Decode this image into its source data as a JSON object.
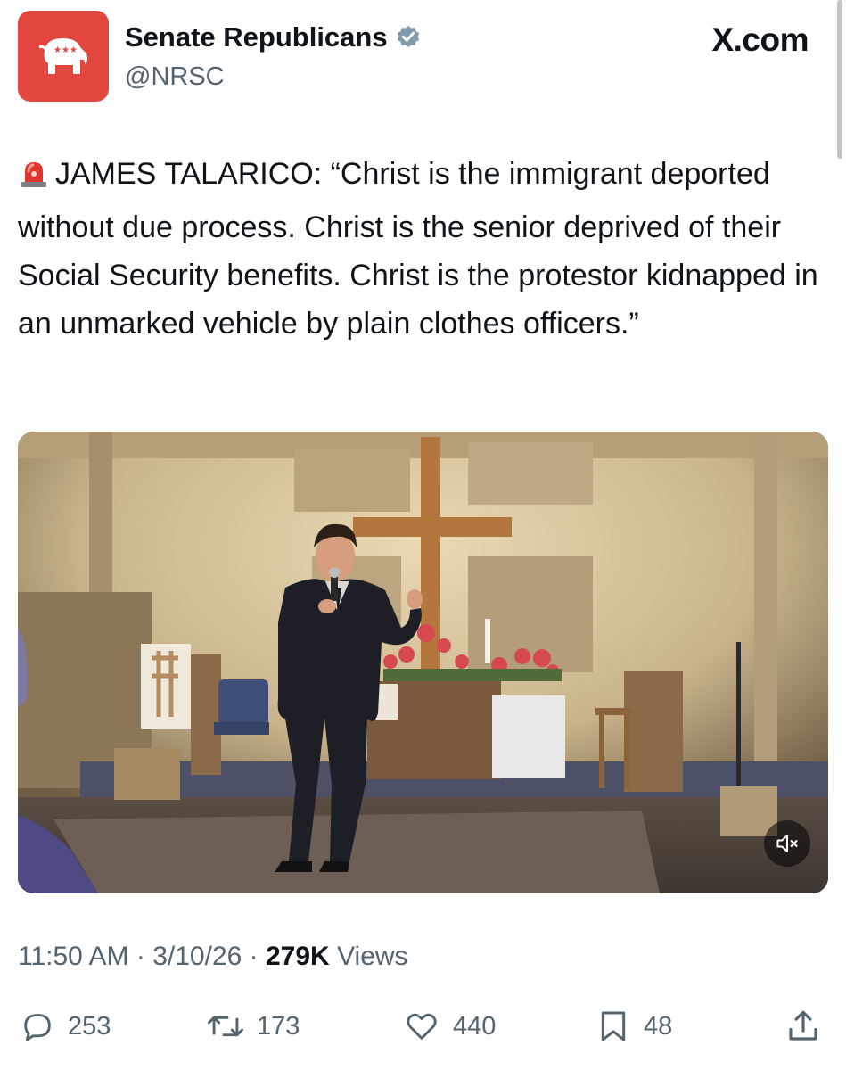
{
  "account": {
    "display_name": "Senate Republicans",
    "handle": "@NRSC",
    "verified": true,
    "avatar_color": "#e2463f"
  },
  "source_label": "X.com",
  "tweet": {
    "emoji": "siren-icon",
    "text": "JAMES TALARICO: “Christ is the immigrant deported without due process. Christ is the senior deprived of their Social Security benefits. Christ is the protestor kidnapped in an unmarked vehicle by plain clothes officers.”"
  },
  "media": {
    "type": "video",
    "muted": true,
    "mute_icon": "muted-speaker-icon"
  },
  "meta": {
    "time": "11:50 AM",
    "separator": "·",
    "date": "3/10/26",
    "views_count": "279K",
    "views_label": "Views"
  },
  "actions": {
    "replies": "253",
    "reposts": "173",
    "likes": "440",
    "bookmarks": "48"
  },
  "colors": {
    "text_primary": "#0f1419",
    "text_secondary": "#536471",
    "verified_badge": "#829aab"
  }
}
